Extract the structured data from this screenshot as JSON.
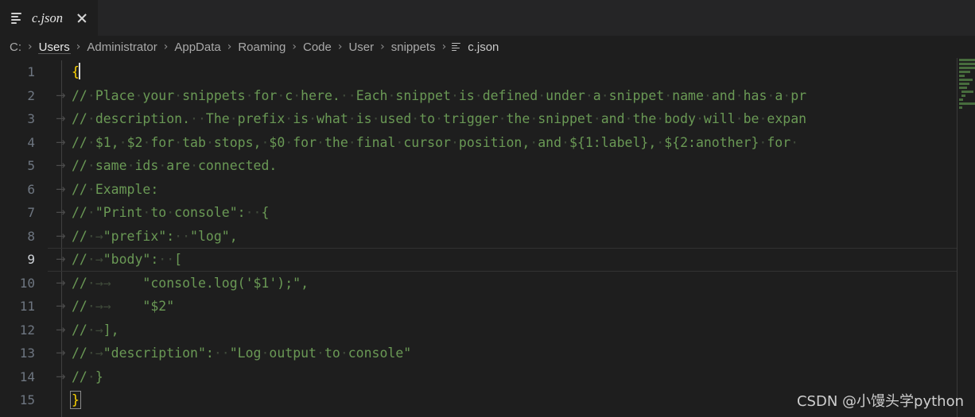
{
  "tab": {
    "label": "c.json",
    "icon": "json-file-icon",
    "close_icon": "close-icon"
  },
  "breadcrumb": {
    "separator": "›",
    "segments": [
      {
        "label": "C:",
        "active": false
      },
      {
        "label": "Users",
        "active": true
      },
      {
        "label": "Administrator",
        "active": false
      },
      {
        "label": "AppData",
        "active": false
      },
      {
        "label": "Roaming",
        "active": false
      },
      {
        "label": "Code",
        "active": false
      },
      {
        "label": "User",
        "active": false
      },
      {
        "label": "snippets",
        "active": false
      }
    ],
    "file": "c.json",
    "file_icon": "json-file-icon"
  },
  "editor": {
    "language": "json",
    "active_line": 9,
    "line_numbers": [
      1,
      2,
      3,
      4,
      5,
      6,
      7,
      8,
      9,
      10,
      11,
      12,
      13,
      14,
      15
    ],
    "whitespace_space_glyph": "·",
    "whitespace_tab_glyph": "→",
    "bracket_color": "#ffd602",
    "comment_color": "#6A9955",
    "background": "#1e1e1e",
    "lines": [
      {
        "n": 1,
        "tab": false,
        "text": "{",
        "kind": "brace",
        "cursor": true
      },
      {
        "n": 2,
        "tab": true,
        "text": "//·Place·your·snippets·for·c·here.··Each·snippet·is·defined·under·a·snippet·name·and·has·a·pr",
        "kind": "comment"
      },
      {
        "n": 3,
        "tab": true,
        "text": "//·description.··The·prefix·is·what·is·used·to·trigger·the·snippet·and·the·body·will·be·expan",
        "kind": "comment"
      },
      {
        "n": 4,
        "tab": true,
        "text": "//·$1,·$2·for·tab·stops,·$0·for·the·final·cursor·position,·and·${1:label},·${2:another}·for·",
        "kind": "comment"
      },
      {
        "n": 5,
        "tab": true,
        "text": "//·same·ids·are·connected.",
        "kind": "comment"
      },
      {
        "n": 6,
        "tab": true,
        "text": "//·Example:",
        "kind": "comment"
      },
      {
        "n": 7,
        "tab": true,
        "text": "//·\"Print·to·console\":··{",
        "kind": "comment"
      },
      {
        "n": 8,
        "tab": true,
        "text": "//·→\"prefix\":··\"log\",",
        "kind": "comment"
      },
      {
        "n": 9,
        "tab": true,
        "text": "//·→\"body\":··[",
        "kind": "comment"
      },
      {
        "n": 10,
        "tab": true,
        "text": "//·→→    \"console.log('$1');\",",
        "kind": "comment"
      },
      {
        "n": 11,
        "tab": true,
        "text": "//·→→    \"$2\"",
        "kind": "comment"
      },
      {
        "n": 12,
        "tab": true,
        "text": "//·→],",
        "kind": "comment"
      },
      {
        "n": 13,
        "tab": true,
        "text": "//·→\"description\":··\"Log·output·to·console\"",
        "kind": "comment"
      },
      {
        "n": 14,
        "tab": true,
        "text": "//·}",
        "kind": "comment"
      },
      {
        "n": 15,
        "tab": false,
        "text": "}",
        "kind": "brace",
        "bracket_match": true
      }
    ]
  },
  "minimap": {
    "name": "minimap",
    "rows": [
      [
        9,
        34
      ],
      [
        9,
        30
      ],
      [
        9,
        27
      ],
      [
        9,
        14
      ],
      [
        9,
        7
      ],
      [
        9,
        17
      ],
      [
        9,
        13
      ],
      [
        9,
        10
      ],
      [
        12,
        15
      ],
      [
        12,
        5
      ],
      [
        9,
        5
      ],
      [
        9,
        24
      ],
      [
        9,
        4
      ]
    ]
  },
  "watermark": {
    "text": "CSDN @小馒头学python"
  }
}
